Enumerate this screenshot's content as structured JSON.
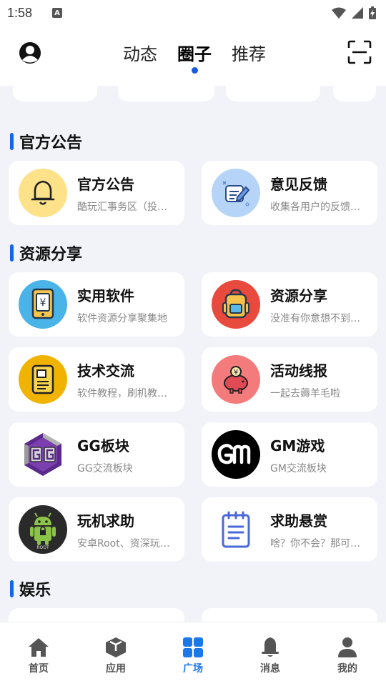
{
  "status_bar": {
    "time": "1:58",
    "notif_letter": "A"
  },
  "top_tabs": [
    {
      "label": "动态",
      "active": false
    },
    {
      "label": "圈子",
      "active": true
    },
    {
      "label": "推荐",
      "active": false
    }
  ],
  "sections": [
    {
      "title": "官方公告"
    },
    {
      "title": "资源分享"
    },
    {
      "title": "娱乐"
    }
  ],
  "cards": [
    {
      "title": "官方公告",
      "subtitle": "酷玩汇事务区（投…",
      "icon": "bell-icon"
    },
    {
      "title": "意见反馈",
      "subtitle": "收集各用户的反馈…",
      "icon": "feedback-icon"
    },
    {
      "title": "实用软件",
      "subtitle": "软件资源分享聚集地",
      "icon": "tablet-yen-icon"
    },
    {
      "title": "资源分享",
      "subtitle": "没准有你意想不到…",
      "icon": "backpack-icon"
    },
    {
      "title": "技术交流",
      "subtitle": "软件教程，刷机教…",
      "icon": "document-icon"
    },
    {
      "title": "活动线报",
      "subtitle": "一起去薅羊毛啦",
      "icon": "piggy-bank-icon"
    },
    {
      "title": "GG板块",
      "subtitle": "GG交流板块",
      "icon": "gg-logo-icon"
    },
    {
      "title": "GM游戏",
      "subtitle": "GM交流板块",
      "icon": "gm-logo-icon"
    },
    {
      "title": "玩机求助",
      "subtitle": "安卓Root、资深玩…",
      "icon": "android-root-icon"
    },
    {
      "title": "求助悬赏",
      "subtitle": "啥？你不会？那可…",
      "icon": "notepad-icon"
    }
  ],
  "bottom_nav": [
    {
      "label": "首页",
      "icon": "home-icon",
      "active": false
    },
    {
      "label": "应用",
      "icon": "cube-icon",
      "active": false
    },
    {
      "label": "广场",
      "icon": "grid-icon",
      "active": true
    },
    {
      "label": "消息",
      "icon": "bell-icon",
      "active": false
    },
    {
      "label": "我的",
      "icon": "person-icon",
      "active": false
    }
  ],
  "colors": {
    "accent": "#1a78e8",
    "section_bar": "#1565e8",
    "background": "#f1f3f8"
  }
}
